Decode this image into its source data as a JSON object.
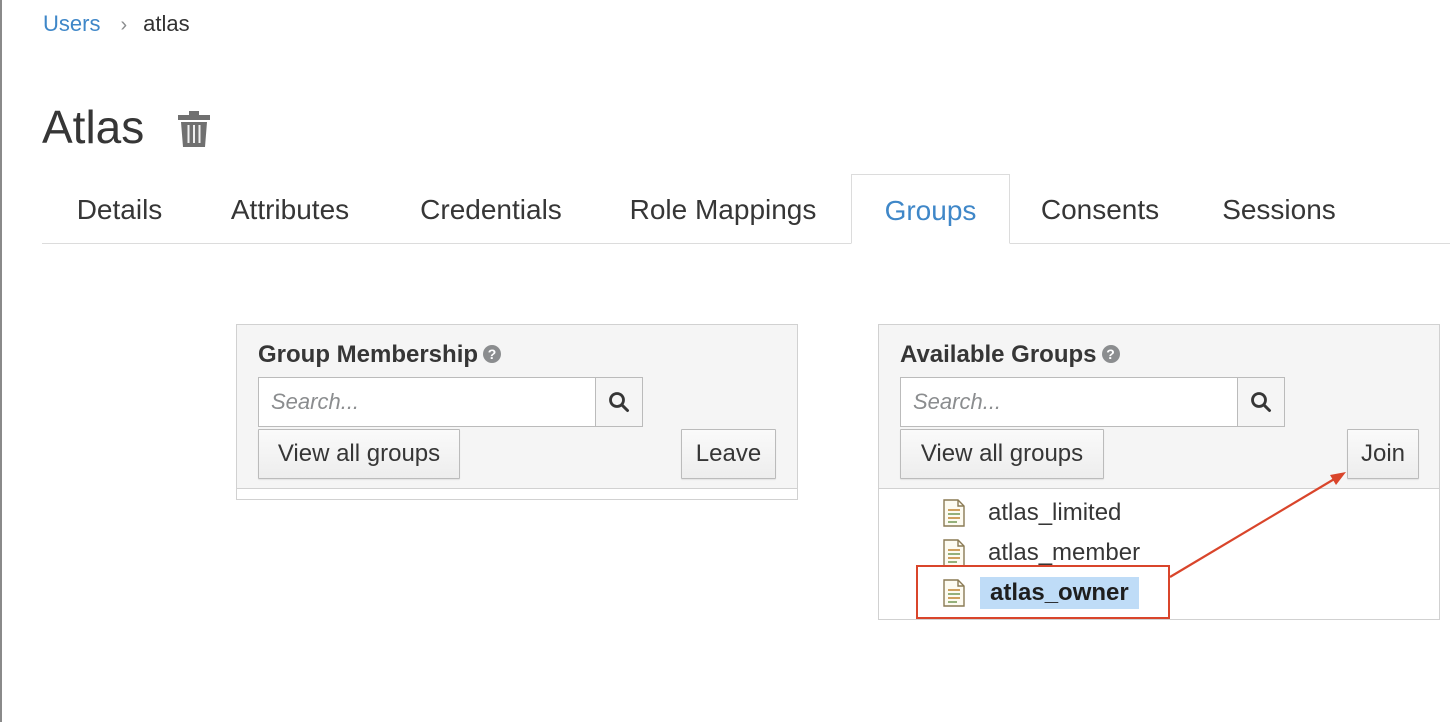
{
  "breadcrumb": {
    "parent": "Users",
    "separator": "›",
    "current": "atlas"
  },
  "page": {
    "title": "Atlas",
    "delete_icon": "trash-icon"
  },
  "tabs": [
    {
      "label": "Details",
      "active": false
    },
    {
      "label": "Attributes",
      "active": false
    },
    {
      "label": "Credentials",
      "active": false
    },
    {
      "label": "Role Mappings",
      "active": false
    },
    {
      "label": "Groups",
      "active": true
    },
    {
      "label": "Consents",
      "active": false
    },
    {
      "label": "Sessions",
      "active": false
    }
  ],
  "group_membership": {
    "title": "Group Membership",
    "help_icon": "?",
    "search_placeholder": "Search...",
    "view_all_label": "View all groups",
    "leave_label": "Leave",
    "items": []
  },
  "available_groups": {
    "title": "Available Groups",
    "help_icon": "?",
    "search_placeholder": "Search...",
    "view_all_label": "View all groups",
    "join_label": "Join",
    "items": [
      {
        "label": "atlas_limited",
        "selected": false
      },
      {
        "label": "atlas_member",
        "selected": false
      },
      {
        "label": "atlas_owner",
        "selected": true
      }
    ]
  },
  "colors": {
    "accent": "#3f87c8",
    "selection": "#bfdcf7",
    "annotation": "#d9452b"
  }
}
